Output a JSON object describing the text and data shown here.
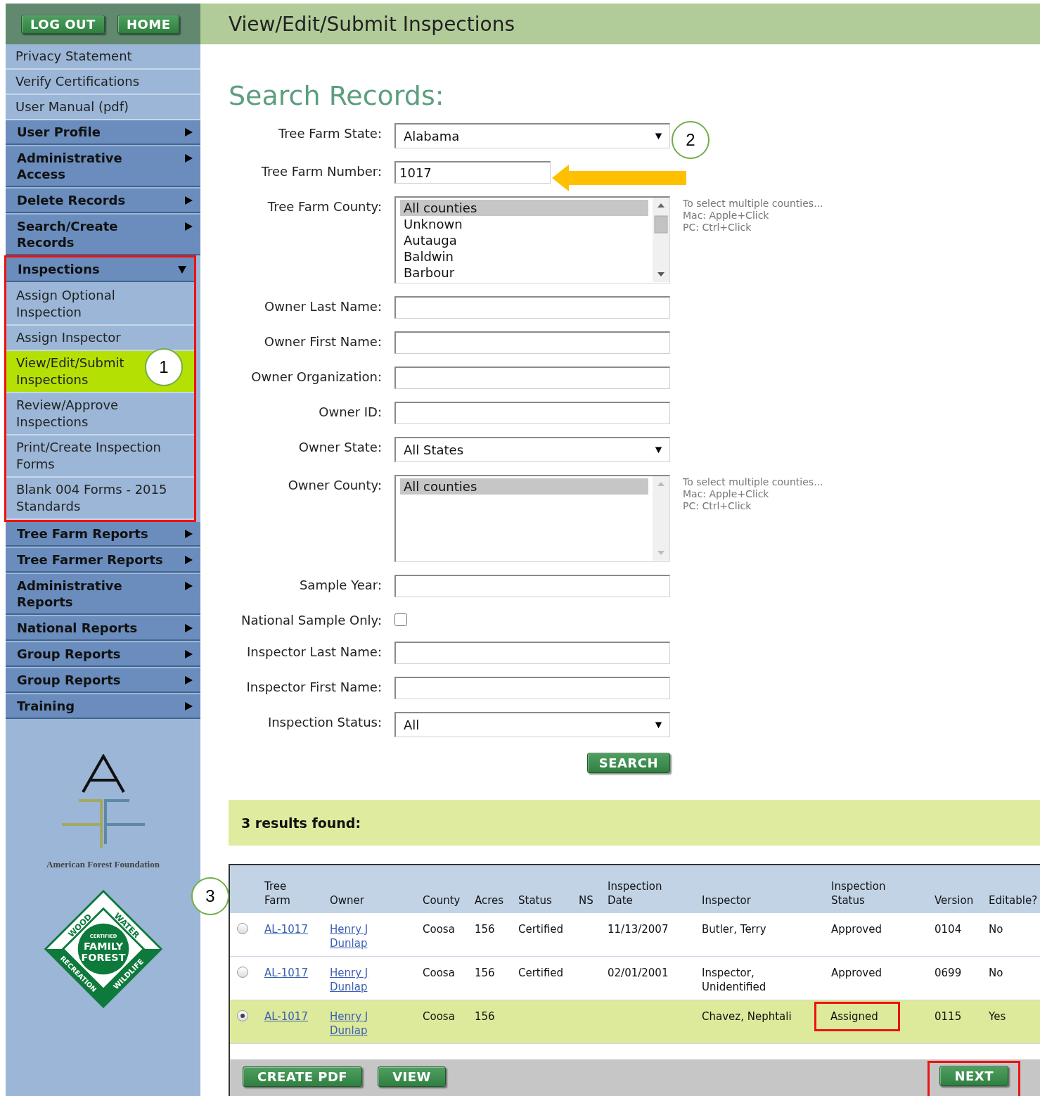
{
  "header": {
    "buttons": [
      {
        "label": "LOG OUT"
      },
      {
        "label": "HOME"
      }
    ],
    "title": "View/Edit/Submit Inspections"
  },
  "sidebar": {
    "items": [
      {
        "kind": "link",
        "label": "Privacy Statement"
      },
      {
        "kind": "link",
        "label": "Verify Certifications"
      },
      {
        "kind": "link",
        "label": "User Manual (pdf)"
      },
      {
        "kind": "section",
        "label": "User Profile",
        "expanded": false,
        "boxed": false
      },
      {
        "kind": "section",
        "label": "Administrative Access",
        "expanded": false,
        "boxed": false
      },
      {
        "kind": "section",
        "label": "Delete Records",
        "expanded": false,
        "boxed": false
      },
      {
        "kind": "section",
        "label": "Search/Create Records",
        "expanded": false,
        "boxed": false
      },
      {
        "kind": "section",
        "label": "Inspections",
        "expanded": true,
        "boxed": true,
        "children": [
          {
            "label": "Assign Optional Inspection",
            "selected": false
          },
          {
            "label": "Assign Inspector",
            "selected": false
          },
          {
            "label": "View/Edit/Submit Inspections",
            "selected": true,
            "marker": "1"
          },
          {
            "label": "Review/Approve Inspections",
            "selected": false
          },
          {
            "label": "Print/Create Inspection Forms",
            "selected": false
          },
          {
            "label": "Blank 004 Forms - 2015 Standards",
            "selected": false
          }
        ]
      },
      {
        "kind": "section",
        "label": "Tree Farm Reports",
        "expanded": false,
        "boxed": false
      },
      {
        "kind": "section",
        "label": "Tree Farmer Reports",
        "expanded": false,
        "boxed": false
      },
      {
        "kind": "section",
        "label": "Administrative Reports",
        "expanded": false,
        "boxed": false
      },
      {
        "kind": "section",
        "label": "National Reports",
        "expanded": false,
        "boxed": false
      },
      {
        "kind": "section",
        "label": "Group Reports",
        "expanded": false,
        "boxed": false
      },
      {
        "kind": "section",
        "label": "Group Reports",
        "expanded": false,
        "boxed": false
      },
      {
        "kind": "section",
        "label": "Training",
        "expanded": false,
        "boxed": false
      }
    ],
    "logo_caption": "American Forest Foundation",
    "badge": {
      "top_left": "WOOD",
      "top_right": "WATER",
      "bottom_left": "RECREATION",
      "bottom_right": "WILDLIFE",
      "seal": [
        "CERTIFIED",
        "FAMILY",
        "FOREST"
      ]
    }
  },
  "search": {
    "heading": "Search Records:",
    "fields": [
      {
        "kind": "select",
        "label": "Tree Farm State:",
        "value": "Alabama",
        "marker": "2"
      },
      {
        "kind": "text",
        "label": "Tree Farm Number:",
        "value": "1017",
        "arrow": true
      },
      {
        "kind": "listbox",
        "label": "Tree Farm County:",
        "options": [
          {
            "label": "All counties",
            "selected": true
          },
          {
            "label": "Unknown",
            "selected": false
          },
          {
            "label": "Autauga",
            "selected": false
          },
          {
            "label": "Baldwin",
            "selected": false
          },
          {
            "label": "Barbour",
            "selected": false
          }
        ],
        "hint": [
          "To select multiple counties...",
          "Mac: Apple+Click",
          "PC: Ctrl+Click"
        ]
      },
      {
        "kind": "text",
        "label": "Owner Last Name:"
      },
      {
        "kind": "text",
        "label": "Owner First Name:"
      },
      {
        "kind": "text",
        "label": "Owner Organization:"
      },
      {
        "kind": "text",
        "label": "Owner ID:"
      },
      {
        "kind": "select",
        "label": "Owner State:",
        "value": "All States"
      },
      {
        "kind": "listbox",
        "label": "Owner County:",
        "options": [
          {
            "label": "All counties",
            "selected": true
          }
        ],
        "hint": [
          "To select multiple counties...",
          "Mac: Apple+Click",
          "PC: Ctrl+Click"
        ]
      },
      {
        "kind": "text",
        "label": "Sample Year:"
      },
      {
        "kind": "checkbox",
        "label": "National Sample Only:",
        "checked": false
      },
      {
        "kind": "text",
        "label": "Inspector Last Name:"
      },
      {
        "kind": "text",
        "label": "Inspector First Name:"
      },
      {
        "kind": "select",
        "label": "Inspection Status:",
        "value": "All"
      }
    ],
    "button": "SEARCH"
  },
  "results": {
    "summary": "3 results found:",
    "marker": "3",
    "columns": [
      "Tree Farm",
      "Owner",
      "County",
      "Acres",
      "Status",
      "NS",
      "Inspection Date",
      "Inspector",
      "Inspection Status",
      "Version",
      "Editable?"
    ],
    "rows": [
      {
        "selected": false,
        "tree_farm": "AL-1017",
        "owner": "Henry J Dunlap",
        "county": "Coosa",
        "acres": "156",
        "status": "Certified",
        "inspection_date": "11/13/2007",
        "inspector": "Butler, Terry",
        "inspection_status": "Approved",
        "status_boxed": false,
        "version": "0104",
        "editable": "No"
      },
      {
        "selected": false,
        "tree_farm": "AL-1017",
        "owner": "Henry J Dunlap",
        "county": "Coosa",
        "acres": "156",
        "status": "Certified",
        "inspection_date": "02/01/2001",
        "inspector": "Inspector, Unidentified",
        "inspection_status": "Approved",
        "status_boxed": false,
        "version": "0699",
        "editable": "No"
      },
      {
        "selected": true,
        "tree_farm": "AL-1017",
        "owner": "Henry J Dunlap",
        "county": "Coosa",
        "acres": "156",
        "inspector": "Chavez, Nephtali",
        "inspection_status": "Assigned",
        "status_boxed": true,
        "version": "0115",
        "editable": "Yes"
      }
    ],
    "buttons": [
      {
        "kind": "action",
        "label": "CREATE PDF",
        "boxed": false
      },
      {
        "kind": "action",
        "label": "VIEW",
        "boxed": false
      },
      {
        "kind": "next",
        "label": "NEXT",
        "boxed": true
      }
    ]
  }
}
